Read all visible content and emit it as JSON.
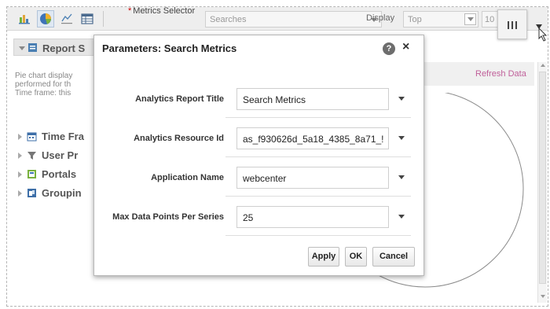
{
  "toolbar": {
    "metrics_label": "Metrics Selector",
    "metrics_value": "Searches",
    "display_label": "Display",
    "display_value": "Top",
    "count_value": "10"
  },
  "left_panel": {
    "report_header": "Report S",
    "report_description": [
      "Pie chart display",
      "performed for th",
      "Time frame: this"
    ],
    "items": [
      {
        "label": "Time Fra",
        "icon": "calendar-icon"
      },
      {
        "label": "User Pr",
        "icon": "filter-icon"
      },
      {
        "label": "Portals",
        "icon": "portal-icon"
      },
      {
        "label": "Groupin",
        "icon": "grouping-icon"
      }
    ]
  },
  "right_panel": {
    "refresh_label": "Refresh Data"
  },
  "dialog": {
    "title": "Parameters: Search Metrics",
    "help_glyph": "?",
    "close_glyph": "×",
    "fields": [
      {
        "label": "Analytics Report Title",
        "value": "Search Metrics"
      },
      {
        "label": "Analytics Resource Id",
        "value": "as_f930626d_5a18_4385_8a71_!"
      },
      {
        "label": "Application Name",
        "value": "webcenter"
      },
      {
        "label": "Max Data Points Per Series",
        "value": "25"
      }
    ],
    "buttons": {
      "apply": "Apply",
      "ok": "OK",
      "cancel": "Cancel"
    }
  },
  "colors": {
    "accent_link": "#c0609a",
    "toolbar_bg": "#eeeeee"
  }
}
